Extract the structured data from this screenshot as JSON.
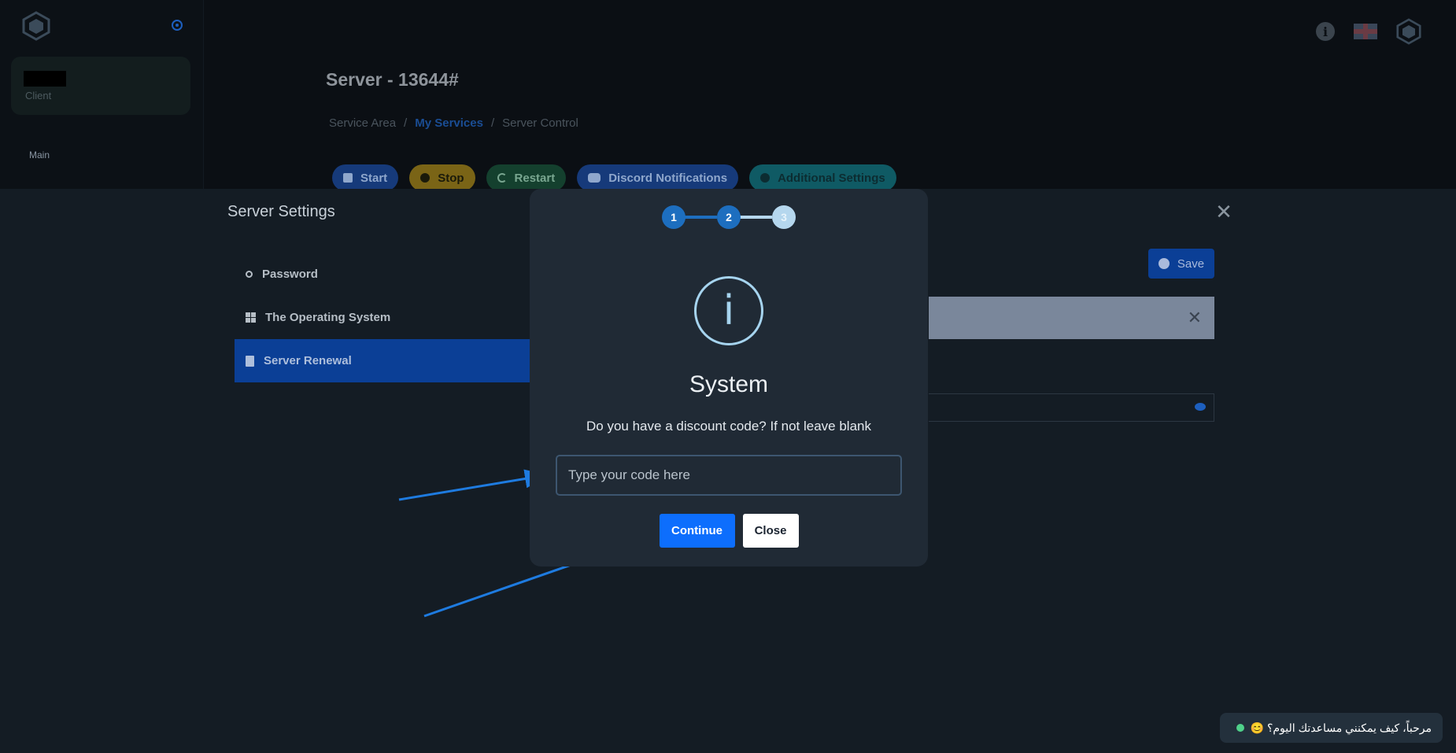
{
  "sidebar": {
    "user_role": "Client",
    "section_label": "Main"
  },
  "header": {
    "page_title": "Server - 13644#",
    "breadcrumb": [
      "Service Area",
      "/",
      "My Services",
      "/",
      "Server Control"
    ]
  },
  "actions": {
    "start": "Start",
    "stop": "Stop",
    "restart": "Restart",
    "discord": "Discord Notifications",
    "additional": "Additional Settings"
  },
  "settings": {
    "title": "Server Settings",
    "menu": [
      {
        "label": "Password",
        "icon": "key-icon"
      },
      {
        "label": "The Operating System",
        "icon": "windows-icon"
      },
      {
        "label": "Server Renewal",
        "icon": "document-icon"
      }
    ],
    "save_label": "Save"
  },
  "modal": {
    "steps": [
      "1",
      "2",
      "3"
    ],
    "current_step": 3,
    "icon": "info-icon",
    "icon_glyph": "i",
    "title": "System",
    "message": "Do you have a discount code? If not leave blank",
    "input_placeholder": "Type your code here",
    "input_value": "",
    "continue_label": "Continue",
    "close_label": "Close"
  },
  "chat": {
    "message": "مرحباً، كيف يمكنني مساعدتك اليوم؟ 😊"
  },
  "colors": {
    "accent": "#0d6efd",
    "step_active": "#1d6ebf",
    "step_pending": "#b5d7ee",
    "annotation_arrow": "#1e7be0"
  }
}
